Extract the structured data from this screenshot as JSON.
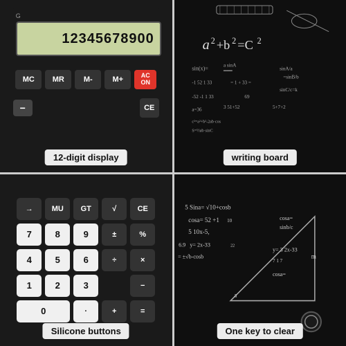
{
  "cells": {
    "top_left": {
      "display_value": "12345678900",
      "display_g": "G",
      "buttons": {
        "row1": [
          "MC",
          "MR",
          "M-",
          "M+"
        ],
        "ac": "AC\nON",
        "ce": "CE",
        "minus_sign": "-"
      },
      "caption": "12-digit display"
    },
    "top_right": {
      "caption": "writing board"
    },
    "bottom_left": {
      "rows": [
        [
          "→",
          "MU",
          "GT",
          "√",
          "CE"
        ],
        [
          "7",
          "8",
          "9",
          "±",
          "%"
        ],
        [
          "4",
          "5",
          "6",
          "÷",
          "×"
        ],
        [
          "1",
          "2",
          "3",
          "",
          "-"
        ],
        [
          "0",
          "",
          "·",
          "",
          "="
        ]
      ],
      "caption": "Silicone buttons"
    },
    "bottom_right": {
      "caption": "One key to clear"
    }
  }
}
